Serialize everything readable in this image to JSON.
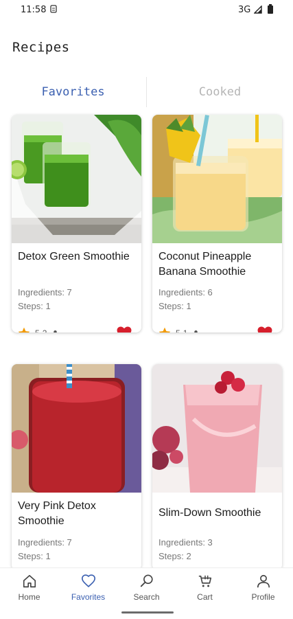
{
  "status_bar": {
    "time": "11:58",
    "network": "3G"
  },
  "page_title": "Recipes",
  "tabs": [
    {
      "label": "Favorites",
      "active": true
    },
    {
      "label": "Cooked",
      "active": false
    }
  ],
  "recipes": [
    {
      "title": "Detox Green Smoothie",
      "ingredients": "Ingredients: 7",
      "steps": "Steps: 1",
      "rating": "5",
      "cooked_count": "2",
      "favorite": true
    },
    {
      "title": "Coconut Pineapple Banana Smoothie",
      "ingredients": "Ingredients: 6",
      "steps": "Steps: 1",
      "rating": "5",
      "cooked_count": "1",
      "favorite": true
    },
    {
      "title": "Very Pink Detox Smoothie",
      "ingredients": "Ingredients: 7",
      "steps": "Steps: 1"
    },
    {
      "title": "Slim-Down Smoothie",
      "ingredients": "Ingredients: 3",
      "steps": "Steps: 2"
    }
  ],
  "bottom_nav": [
    {
      "label": "Home",
      "icon": "home-icon",
      "active": false
    },
    {
      "label": "Favorites",
      "icon": "heart-outline-icon",
      "active": true
    },
    {
      "label": "Search",
      "icon": "search-icon",
      "active": false
    },
    {
      "label": "Cart",
      "icon": "cart-icon",
      "active": false
    },
    {
      "label": "Profile",
      "icon": "person-icon",
      "active": false
    }
  ],
  "colors": {
    "accent": "#3a5fb0",
    "favorite": "#d61f2c",
    "star": "#f29900",
    "inactive_tab": "#b5b5b5"
  }
}
